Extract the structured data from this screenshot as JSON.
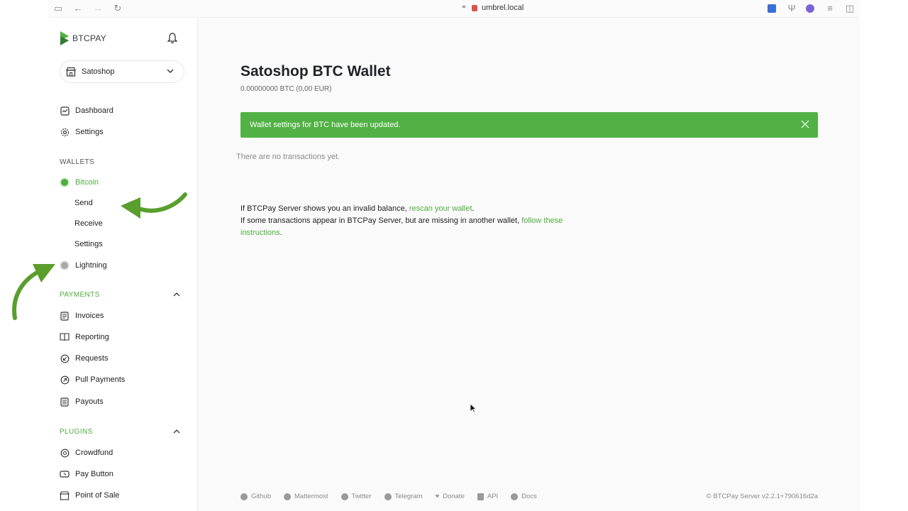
{
  "browser": {
    "url": "umbrel.local"
  },
  "sidebar": {
    "logo_text": "BTCPAY",
    "store_name": "Satoshop",
    "nav": {
      "dashboard": "Dashboard",
      "settings": "Settings"
    },
    "wallets": {
      "heading": "WALLETS",
      "bitcoin": "Bitcoin",
      "send": "Send",
      "receive": "Receive",
      "settings": "Settings",
      "lightning": "Lightning"
    },
    "payments": {
      "heading": "PAYMENTS",
      "invoices": "Invoices",
      "reporting": "Reporting",
      "requests": "Requests",
      "pull_payments": "Pull Payments",
      "payouts": "Payouts"
    },
    "plugins": {
      "heading": "PLUGINS",
      "crowdfund": "Crowdfund",
      "pay_button": "Pay Button",
      "point_of_sale": "Point of Sale"
    }
  },
  "main": {
    "title": "Satoshop BTC Wallet",
    "balance": "0.00000000 BTC (0,00 EUR)",
    "alert": "Wallet settings for BTC have been updated.",
    "empty": "There are no transactions yet.",
    "info": {
      "line1_prefix": "If BTCPay Server shows you an invalid balance, ",
      "line1_link": "rescan your wallet",
      "line1_suffix": ".",
      "line2_prefix": "If some transactions appear in BTCPay Server, but are missing in another wallet, ",
      "line2_link": "follow these instructions",
      "line2_suffix": "."
    }
  },
  "footer": {
    "links": [
      "Github",
      "Mattermost",
      "Twitter",
      "Telegram",
      "Donate",
      "API",
      "Docs"
    ],
    "version": "© BTCPay Server v2.2.1+790616d2a"
  },
  "colors": {
    "accent": "#51b144",
    "link": "#4caf3c"
  }
}
